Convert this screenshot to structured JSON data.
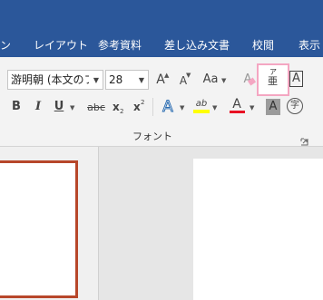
{
  "ribbon_tabs": [
    "ン",
    "レイアウト",
    "参考資料",
    "差し込み文書",
    "校閲",
    "表示"
  ],
  "font_group": {
    "font_name": "游明朝 (本文のフ:",
    "font_size": "28",
    "label": "フォント"
  },
  "icons": {
    "grow_font": "A",
    "shrink_font": "A",
    "change_case": "Aa",
    "clear_formatting": "A",
    "phonetic_guide": "亜",
    "phonetic_ruby": "ア",
    "character_border": "A",
    "bold": "B",
    "italic": "I",
    "underline": "U",
    "strikethrough": "abc",
    "subscript_base": "x",
    "subscript_mark": "2",
    "superscript_base": "x",
    "superscript_mark": "2",
    "text_effects": "A",
    "highlight": "ab",
    "font_color": "A",
    "character_shading": "A",
    "enclosed_character": "字"
  },
  "colors": {
    "tab_bar": "#2b579a",
    "highlight_yellow": "#ffff00",
    "font_color_red": "#e81123",
    "selection_pink": "#f4a6c2",
    "slide_border": "#b7472a"
  }
}
